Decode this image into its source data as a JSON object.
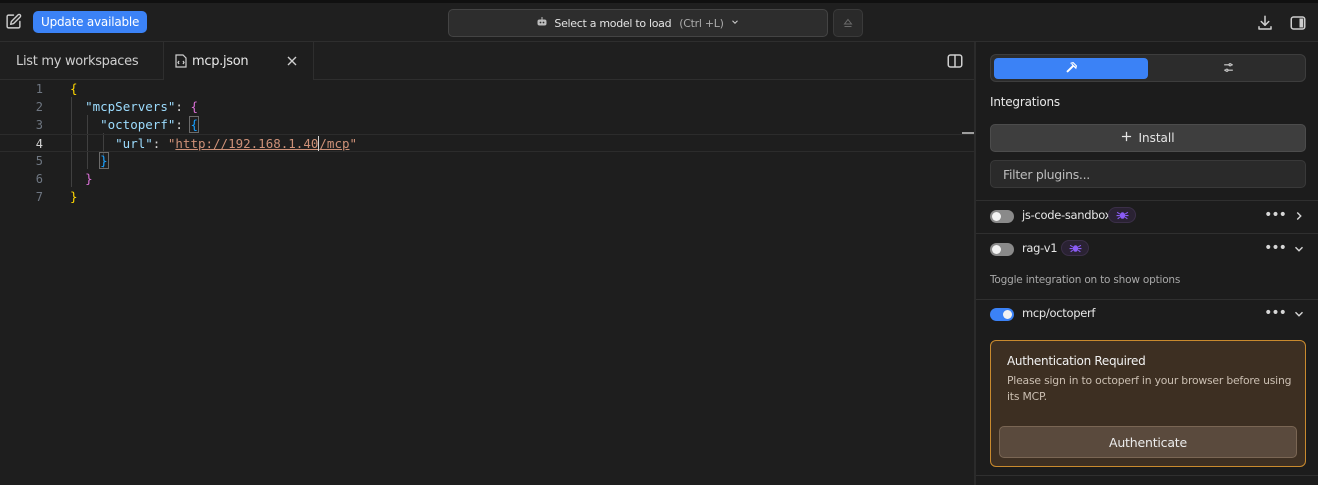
{
  "topbar": {
    "update_label": "Update available",
    "model_select_label": "Select a model to load",
    "model_select_shortcut": "(Ctrl +L)"
  },
  "tabs": [
    {
      "label": "List my workspaces"
    },
    {
      "label": "mcp.json"
    }
  ],
  "editor": {
    "line_numbers": [
      "1",
      "2",
      "3",
      "4",
      "5",
      "6",
      "7"
    ],
    "current_line": 4
  },
  "panel": {
    "title": "Integrations",
    "install_label": "Install",
    "filter_placeholder": "Filter plugins...",
    "plugins": [
      {
        "name": "js-code-sandbox",
        "enabled": false
      },
      {
        "name": "rag-v1",
        "enabled": false
      },
      {
        "name": "mcp/octoperf",
        "enabled": true
      }
    ],
    "hint": "Toggle integration on to show options",
    "auth": {
      "title": "Authentication Required",
      "description": "Please sign in to octoperf in your browser before using its MCP.",
      "button_label": "Authenticate"
    }
  },
  "colors": {
    "accent": "#3b82f6",
    "warning_border": "#c98a2e"
  }
}
